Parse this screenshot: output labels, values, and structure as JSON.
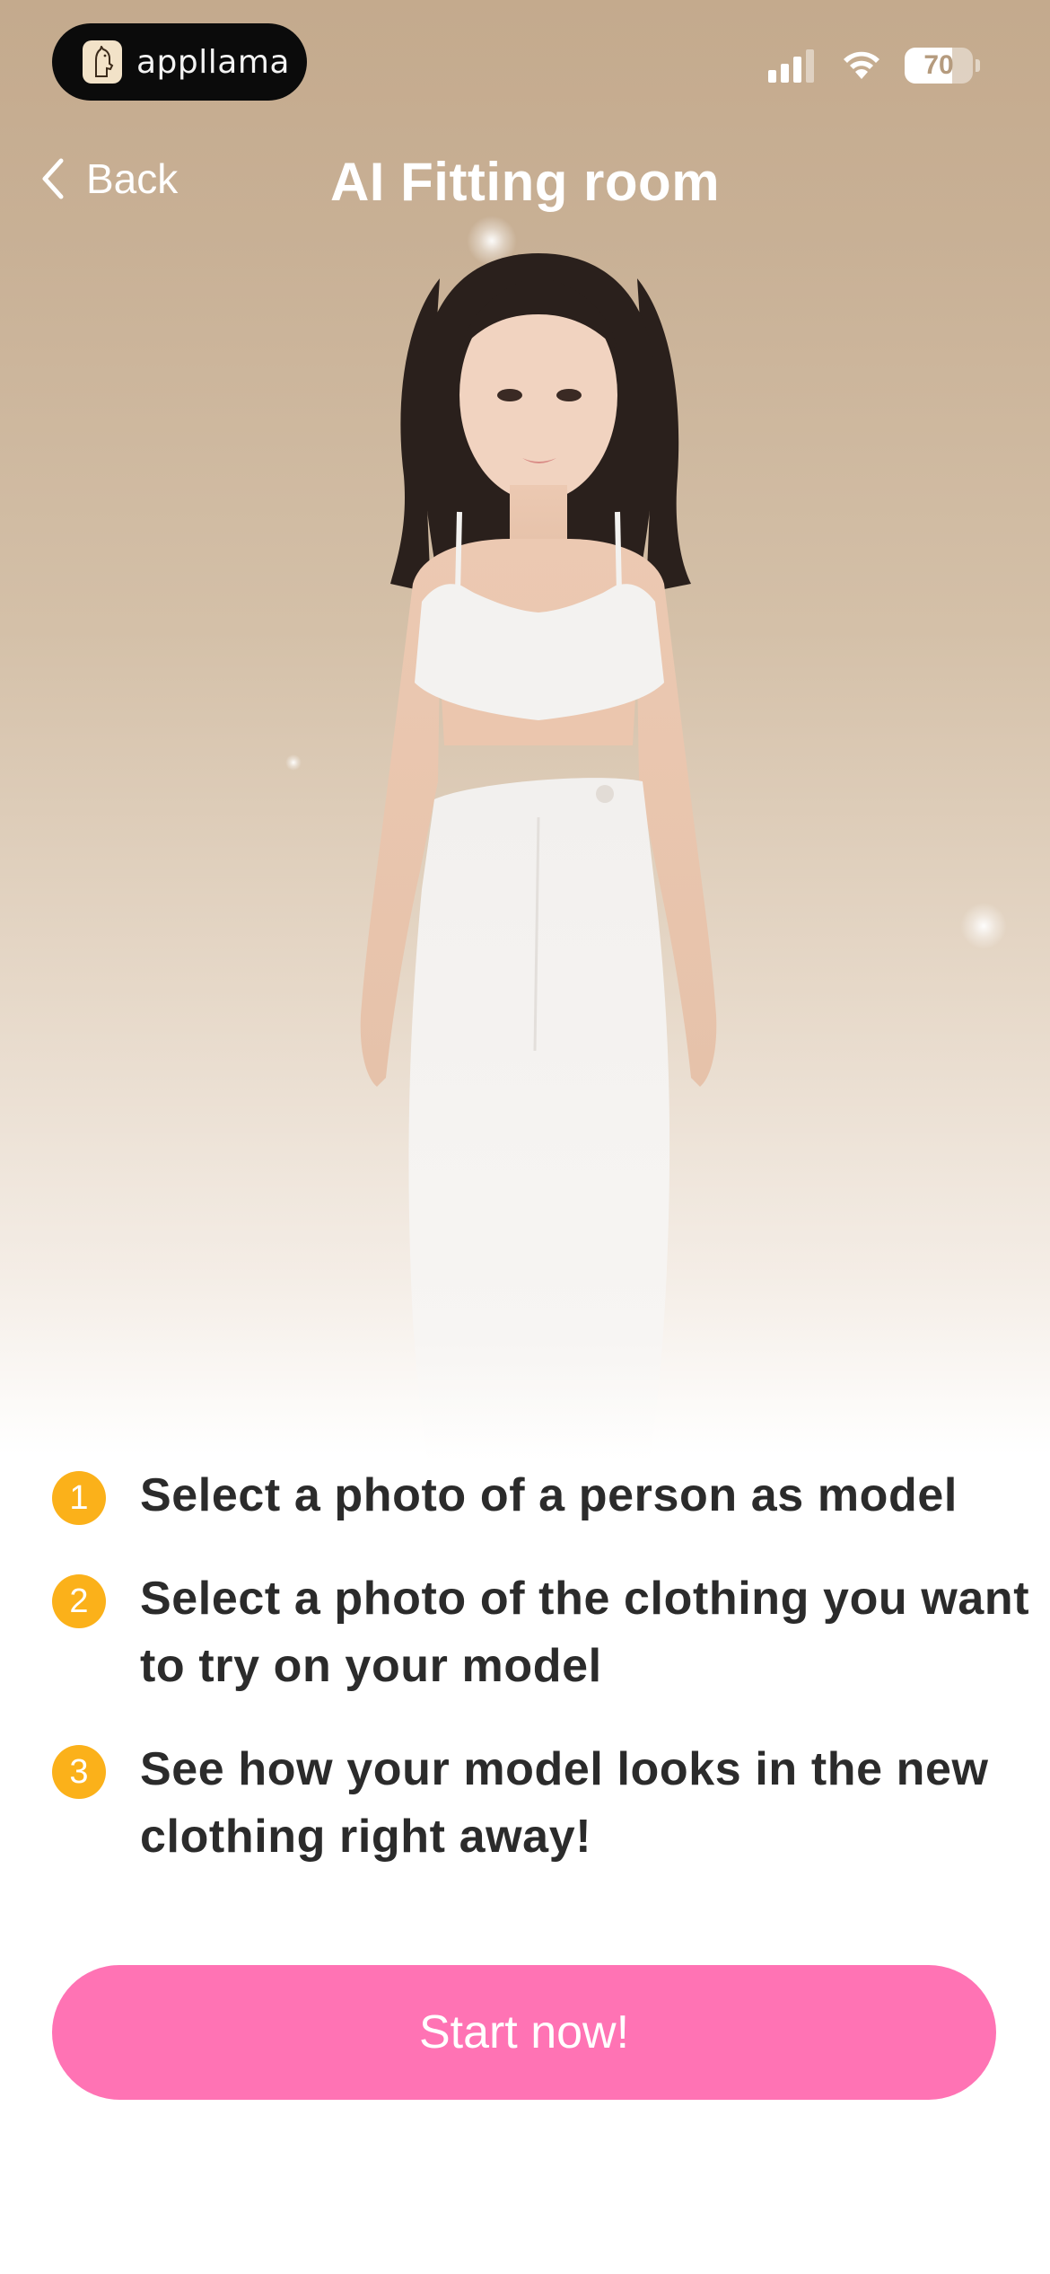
{
  "status_bar": {
    "app_badge_name": "appllama",
    "battery_level": "70",
    "battery_fraction": 0.7,
    "signal_icon": "cellular-signal-icon",
    "wifi_icon": "wifi-icon"
  },
  "nav": {
    "back_label": "Back",
    "title": "AI Fitting room"
  },
  "steps": [
    {
      "number": "1",
      "text": "Select a photo of a person as model"
    },
    {
      "number": "2",
      "text": "Select a photo of the clothing you want to try on your model"
    },
    {
      "number": "3",
      "text": "See how your model looks in the new clothing right away!"
    }
  ],
  "cta": {
    "label": "Start now!"
  },
  "colors": {
    "accent_pink": "#ff73b4",
    "step_badge": "#fbb11a",
    "hero_top": "#c4aa8d"
  }
}
